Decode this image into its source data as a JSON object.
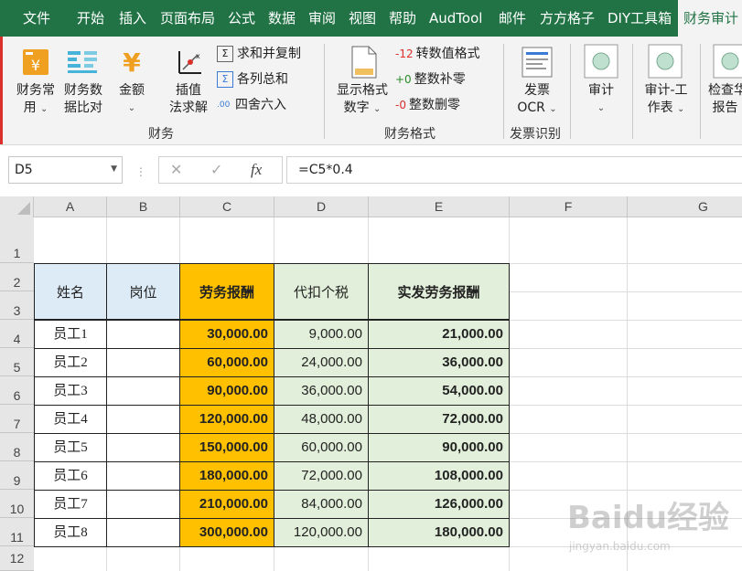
{
  "ribbon_tabs": [
    "文件",
    "开始",
    "插入",
    "页面布局",
    "公式",
    "数据",
    "审阅",
    "视图",
    "帮助",
    "AudTool",
    "邮件",
    "方方格子",
    "DIY工具箱",
    "财务审计"
  ],
  "ribbon": {
    "buttons": {
      "finance_common": {
        "line1": "财务常",
        "line2": "用"
      },
      "finance_compare": {
        "line1": "财务数",
        "line2": "据比对"
      },
      "amount": {
        "line1": "金额"
      },
      "interp": {
        "line1": "插值",
        "line2": "法求解"
      },
      "sum_copy": "求和并复制",
      "col_sum": "各列总和",
      "round": "四舍六入",
      "display_fmt": {
        "line1": "显示格式",
        "line2": "数字"
      },
      "to_value_fmt": "转数值格式",
      "pad_zero": "整数补零",
      "del_zero": "整数删零",
      "invoice_ocr": {
        "line1": "发票",
        "line2": "OCR"
      },
      "audit": {
        "line1": "审计"
      },
      "audit_paper": {
        "line1": "审计-工",
        "line2": "作表"
      },
      "check_report": {
        "line1": "检查华",
        "line2": "报告"
      }
    },
    "small_icons": {
      "to_value": "-12",
      "pad": "+0",
      "del": "-0"
    },
    "groups": {
      "finance": "财务",
      "finance_format": "财务格式",
      "invoice": "发票识别"
    }
  },
  "formula_bar": {
    "name_box": "D5",
    "fx": "fx",
    "formula": "=C5*0.4"
  },
  "columns": [
    "A",
    "B",
    "C",
    "D",
    "E",
    "F",
    "G"
  ],
  "rows": [
    "1",
    "2",
    "3",
    "4",
    "5",
    "6",
    "7",
    "8",
    "9",
    "10",
    "11",
    "12"
  ],
  "table": {
    "headers": [
      "姓名",
      "岗位",
      "劳务报酬",
      "代扣个税",
      "实发劳务报酬"
    ],
    "rows": [
      [
        "员工1",
        "",
        "30,000.00",
        "9,000.00",
        "21,000.00"
      ],
      [
        "员工2",
        "",
        "60,000.00",
        "24,000.00",
        "36,000.00"
      ],
      [
        "员工3",
        "",
        "90,000.00",
        "36,000.00",
        "54,000.00"
      ],
      [
        "员工4",
        "",
        "120,000.00",
        "48,000.00",
        "72,000.00"
      ],
      [
        "员工5",
        "",
        "150,000.00",
        "60,000.00",
        "90,000.00"
      ],
      [
        "员工6",
        "",
        "180,000.00",
        "72,000.00",
        "108,000.00"
      ],
      [
        "员工7",
        "",
        "210,000.00",
        "84,000.00",
        "126,000.00"
      ],
      [
        "员工8",
        "",
        "300,000.00",
        "120,000.00",
        "180,000.00"
      ]
    ]
  },
  "colors": {
    "ribbon_green": "#217346",
    "header_blue": "#ddebf7",
    "header_orange": "#ffc000",
    "header_green": "#e2efda"
  },
  "watermark": {
    "brand": "Baidu经验",
    "url": "jingyan.baidu.com"
  }
}
